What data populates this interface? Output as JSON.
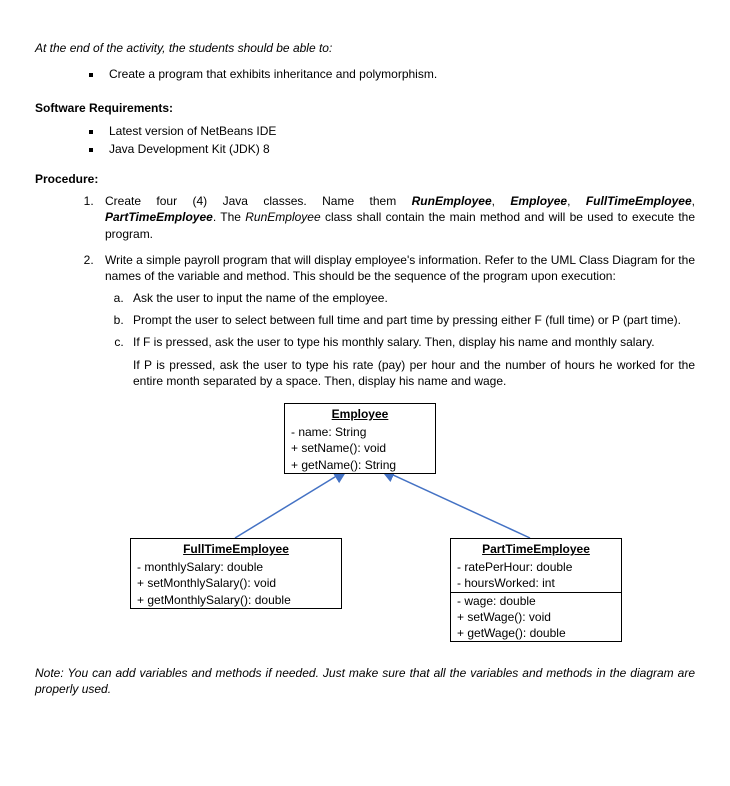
{
  "intro": "At the end of the activity, the students should be able to:",
  "objective": "Create a program that exhibits inheritance and polymorphism.",
  "softwareHeading": "Software Requirements:",
  "software": [
    "Latest version of NetBeans IDE",
    "Java Development Kit (JDK) 8"
  ],
  "procedureHeading": "Procedure:",
  "step1": {
    "pre": "Create four (4) Java classes. Name them ",
    "c1": "RunEmployee",
    "sep1": ", ",
    "c2": "Employee",
    "sep2": ", ",
    "c3": "FullTimeEmployee",
    "sep3": ", ",
    "c4": "PartTimeEmployee",
    "mid": ". The ",
    "c5": "RunEmployee",
    "post": " class shall contain the main method and will be used to execute the program."
  },
  "step2": {
    "text": "Write a simple payroll program that will display employee's information. Refer to the UML Class Diagram for the names of the variable and method. This should be the sequence of the program upon execution:",
    "a": "Ask the user to input the name of the employee.",
    "b": "Prompt the user to select between full time and part time by pressing either F (full time) or P (part time).",
    "c": "If F is pressed, ask the user to type his monthly salary. Then, display his name and monthly salary.",
    "cAfter": "If P is pressed, ask the user to type his rate (pay) per hour and the number of hours he worked for the entire month separated by a space. Then, display his name and wage."
  },
  "uml": {
    "employee": {
      "title": "Employee",
      "r1": "-  name: String",
      "r2": "+  setName(): void",
      "r3": "+  getName(): String"
    },
    "ft": {
      "title": "FullTimeEmployee",
      "r1": "-   monthlySalary: double",
      "r2": "+  setMonthlySalary(): void",
      "r3": "+  getMonthlySalary(): double"
    },
    "pt": {
      "title": "PartTimeEmployee",
      "r1": "-   ratePerHour: double",
      "r2": "-   hoursWorked: int",
      "r3": "-   wage: double",
      "r4": "+  setWage(): void",
      "r5": "+  getWage(): double"
    }
  },
  "note": "Note: You can add variables and methods if needed. Just make sure that all the variables and methods in the diagram are properly used."
}
